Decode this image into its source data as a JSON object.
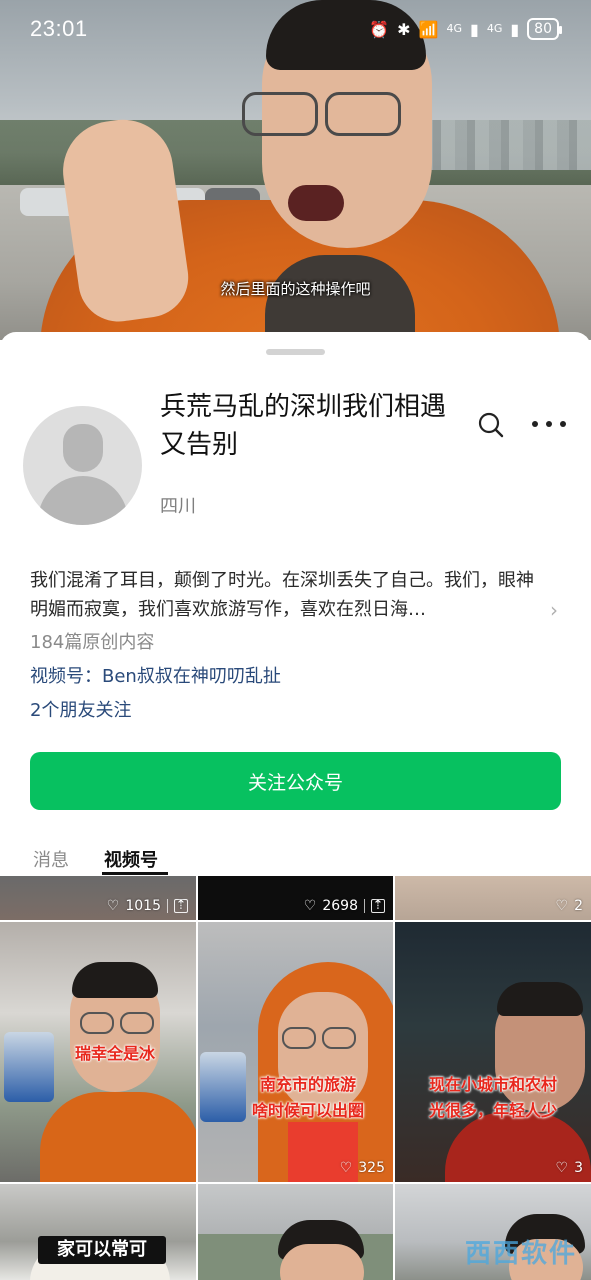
{
  "status_bar": {
    "time": "23:01",
    "battery": "80",
    "network_1": "4G",
    "network_2": "4G"
  },
  "video": {
    "subtitle": "然后里面的这种操作吧"
  },
  "account": {
    "name": "兵荒马乱的深圳我们相遇又告别",
    "region": "四川",
    "description": "我们混淆了耳目，颠倒了时光。在深圳丢失了自己。我们，眼神明媚而寂寞，我们喜欢旅游写作，喜欢在烈日海…",
    "original_count": "184篇原创内容",
    "channel": "视频号：Ben叔叔在神叨叨乱扯",
    "friends": "2个朋友关注",
    "follow_label": "关注公众号"
  },
  "tabs": {
    "messages": "消息",
    "channels": "视频号"
  },
  "grid": {
    "row1": [
      {
        "likes": "1015",
        "pinned": true
      },
      {
        "likes": "2698",
        "pinned": true
      },
      {
        "likes": "2",
        "pinned": false
      }
    ],
    "row2": [
      {
        "likes": "",
        "caption": "瑞幸全是冰"
      },
      {
        "likes": "325",
        "caption": "南充市的旅游\n啥时候可以出圈"
      },
      {
        "likes": "3",
        "caption": "现在小城市和农村\n光很多，年轻人少"
      }
    ],
    "row3": [
      {
        "caption": "家可以常可"
      },
      {
        "caption": ""
      },
      {
        "caption": ""
      }
    ]
  },
  "watermark": "西西软件",
  "colors": {
    "follow_button": "#07c160",
    "link": "#2a4a7a",
    "caption_red": "#e8281d"
  }
}
